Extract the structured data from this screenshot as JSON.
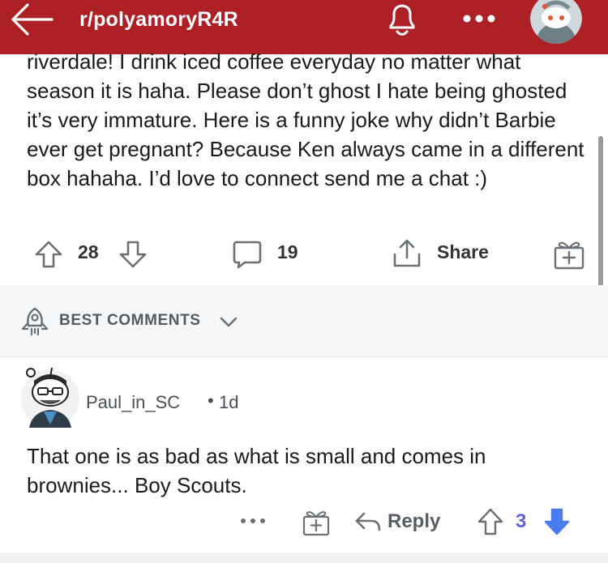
{
  "header": {
    "subreddit": "r/polyamoryR4R",
    "icons": [
      "back-arrow-icon",
      "bell-icon",
      "more-dots-icon",
      "user-avatar"
    ]
  },
  "post": {
    "body": "riverdale! I drink iced coffee everyday no matter what season it is haha. Please don’t ghost I hate being ghosted it’s very immature. Here is a funny joke why didn’t Barbie ever get pregnant? Because Ken always came in a different box hahaha. I’d love to connect send me a chat :)",
    "upvotes": "28",
    "comments": "19",
    "share_label": "Share"
  },
  "sort": {
    "label": "BEST COMMENTS"
  },
  "comment": {
    "author": "Paul_in_SC",
    "separator": "•",
    "age": "1d",
    "text": "That one is as bad as what is small and comes in brownies... Boy Scouts.",
    "more_label": "•••",
    "reply_label": "Reply",
    "score": "3"
  },
  "colors": {
    "header_bg": "#ad2126",
    "upvote_active": "#6062e0",
    "downvote_active": "#4a7bef"
  }
}
